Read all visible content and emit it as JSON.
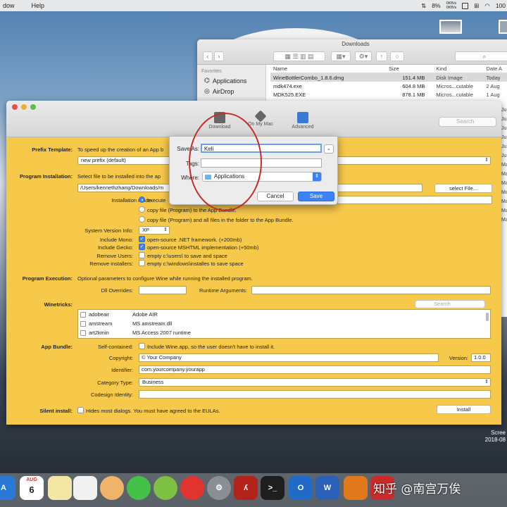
{
  "menubar": {
    "items": [
      "dow",
      "Help"
    ],
    "battery": "8%",
    "net_up": "0KB/s",
    "net_down": "0KB/s",
    "percent": "100"
  },
  "desktop": {
    "screenshot_label": "Scree",
    "screenshot_date": "2018-08"
  },
  "finder": {
    "title": "Downloads",
    "sidebar_header": "Favorites",
    "sidebar_items": [
      "Applications",
      "AirDrop"
    ],
    "columns": [
      "Name",
      "Size",
      "Kind",
      "Date A"
    ],
    "rows": [
      {
        "name": "WineBottlerCombo_1.8.6.dmg",
        "size": "151.4 MB",
        "kind": "Disk Image",
        "date": "Today"
      },
      {
        "name": "mdk474.exe",
        "size": "604.8 MB",
        "kind": "Micros...cutable",
        "date": "2 Aug"
      },
      {
        "name": "MDK525.EXE",
        "size": "878.1 MB",
        "kind": "Micros...cutable",
        "date": "1 Aug"
      }
    ],
    "right_dates": [
      "Ju",
      "Ju",
      "Ju",
      "Ju",
      "Ju",
      "Ju",
      "Ma",
      "Ma",
      "Ma",
      "Ma",
      "Ma",
      "Ma",
      "Ma"
    ]
  },
  "wine": {
    "toolbar": [
      "Download",
      "On My Mac",
      "Advanced"
    ],
    "search_placeholder": "Search",
    "prefix_template_label": "Prefix Template:",
    "prefix_template_text": "To speed up the creation of an App b",
    "prefix_value": "new prefix (default)",
    "program_installation_label": "Program Installation:",
    "program_installation_text": "Select file to be installed into the ap",
    "program_path": "/Users/kennethzhang/Downloads/m",
    "select_file_button": "select File...",
    "installation_mode_label": "Installation mode:",
    "mode_options": [
      "execute",
      "copy file (Program)  to the App Bundle.",
      "copy file (Program)  and all files in the folder to the App Bundle."
    ],
    "system_version_label": "System Version Info:",
    "system_version_value": "XP",
    "options": [
      {
        "label": "Include Mono:",
        "text": "open-source .NET framework. (+200mb)",
        "checked": true
      },
      {
        "label": "Include Gecko:",
        "text": "open-source MSHTML implementation (+50mb)",
        "checked": true
      },
      {
        "label": "Remove Users:",
        "text": "empty c:\\users\\ to save and space",
        "checked": false
      },
      {
        "label": "Remove installers:",
        "text": "empty c:\\windows\\installes to save space",
        "checked": false
      }
    ],
    "program_execution_label": "Program Execution:",
    "program_execution_text": "Optional parameters to configure Wine while running the installed program.",
    "dll_overrides_label": "Dll Overrides:",
    "runtime_args_label": "Runtime Arguments:",
    "winetricks_label": "Winetricks:",
    "winetricks_search": "Search",
    "winetricks": [
      {
        "name": "adobeair",
        "desc": "Adobe AIR"
      },
      {
        "name": "amstream",
        "desc": "MS amstream.dll"
      },
      {
        "name": "art2kmin",
        "desc": "MS Access 2007 runtime"
      }
    ],
    "app_bundle_label": "App Bundle:",
    "self_contained_label": "Self-contained:",
    "self_contained_text": "Include Wine.app, so the user doesn't have to install it.",
    "copyright_label": "Copyright:",
    "copyright_value": "© Your Company",
    "version_label": "Version:",
    "version_value": "1.0.0",
    "identifier_label": "Identifier:",
    "identifier_value": "com.yourcompany.yourapp",
    "category_label": "Category Type:",
    "category_value": "Business",
    "codesign_label": "Codesign Identity:",
    "silent_install_label": "Silent install:",
    "silent_install_text": "Hides most dialogs. You must have agreed to the EULAs.",
    "install_button": "Install"
  },
  "save_dialog": {
    "save_as_label": "Save As:",
    "save_as_value": "Keli",
    "tags_label": "Tags:",
    "where_label": "Where:",
    "where_value": "Applications",
    "cancel": "Cancel",
    "save": "Save"
  },
  "dock": {
    "calendar_month": "AUG",
    "calendar_day": "6"
  },
  "watermark": "知乎 @南宫万俟"
}
